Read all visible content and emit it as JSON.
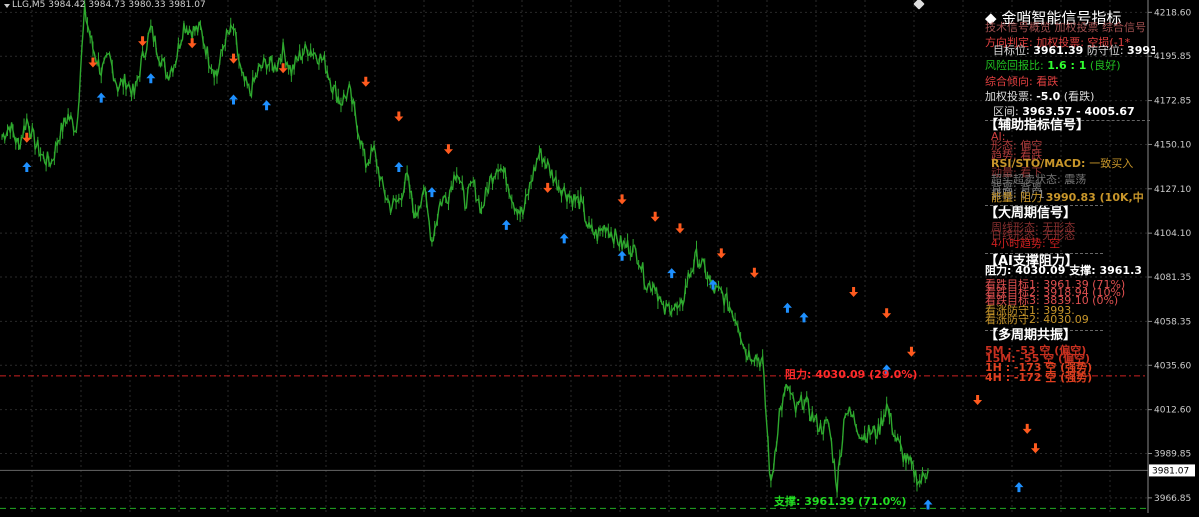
{
  "header": {
    "symbol_timeframe": "LLG,M5",
    "ohlc": "3984.42 3984.73 3980.33 3981.07"
  },
  "colors": {
    "background": "#000000",
    "candle": "#2ea82e",
    "grid": "#2a2a2a",
    "resistance": "#cc2222",
    "support": "#22aa22",
    "buy_arrow": "#1e90ff",
    "sell_arrow": "#ff5a1e"
  },
  "price_axis": {
    "ticks": [
      "4218.60",
      "4195.85",
      "4172.85",
      "4150.10",
      "4127.10",
      "4104.10",
      "4081.35",
      "4058.35",
      "4035.60",
      "4012.60",
      "3989.85",
      "3966.85"
    ],
    "current_price": "3981.07"
  },
  "chart_data": {
    "type": "line",
    "title": "",
    "xlabel": "",
    "ylabel": "",
    "ylim": [
      3959,
      4225
    ],
    "series": [
      {
        "values": [
          4154,
          4160,
          4149,
          4163,
          4151,
          4143,
          4141,
          4156,
          4165,
          4158,
          4219,
          4200,
          4188,
          4195,
          4180,
          4183,
          4176,
          4195,
          4210,
          4197,
          4186,
          4194,
          4212,
          4209,
          4210,
          4195,
          4186,
          4205,
          4210,
          4185,
          4177,
          4188,
          4193,
          4190,
          4199,
          4188,
          4196,
          4200,
          4197,
          4193,
          4180,
          4172,
          4178,
          4160,
          4140,
          4147,
          4128,
          4118,
          4121,
          4133,
          4112,
          4128,
          4100,
          4120,
          4124,
          4138,
          4120,
          4130,
          4116,
          4131,
          4140,
          4133,
          4119,
          4114,
          4131,
          4146,
          4139,
          4131,
          4126,
          4122,
          4120,
          4106,
          4103,
          4108,
          4103,
          4098,
          4097,
          4092,
          4077,
          4078,
          4063,
          4067,
          4063,
          4081,
          4092,
          4085,
          4075,
          4073,
          4066,
          4058,
          4042,
          4041,
          4037,
          3972,
          4010,
          4025,
          4012,
          4018,
          4009,
          4003,
          4005,
          3973,
          4013,
          4008,
          3999,
          4001,
          4001,
          4015,
          3999,
          3989,
          3983,
          3975,
          3981
        ]
      }
    ],
    "buy_signals": [
      {
        "i": 3,
        "price": 4141
      },
      {
        "i": 12,
        "price": 4177
      },
      {
        "i": 18,
        "price": 4187
      },
      {
        "i": 28,
        "price": 4176
      },
      {
        "i": 32,
        "price": 4173
      },
      {
        "i": 48,
        "price": 4141
      },
      {
        "i": 52,
        "price": 4128
      },
      {
        "i": 61,
        "price": 4111
      },
      {
        "i": 68,
        "price": 4104
      },
      {
        "i": 75,
        "price": 4095
      },
      {
        "i": 81,
        "price": 4086
      },
      {
        "i": 86,
        "price": 4080
      },
      {
        "i": 95,
        "price": 4068
      },
      {
        "i": 97,
        "price": 4063
      },
      {
        "i": 107,
        "price": 4036
      },
      {
        "i": 112,
        "price": 3966
      },
      {
        "i": 123,
        "price": 3975
      }
    ],
    "sell_signals": [
      {
        "i": 3,
        "price": 4151
      },
      {
        "i": 11,
        "price": 4190
      },
      {
        "i": 17,
        "price": 4201
      },
      {
        "i": 23,
        "price": 4200
      },
      {
        "i": 28,
        "price": 4192
      },
      {
        "i": 34,
        "price": 4187
      },
      {
        "i": 44,
        "price": 4180
      },
      {
        "i": 48,
        "price": 4162
      },
      {
        "i": 54,
        "price": 4145
      },
      {
        "i": 66,
        "price": 4125
      },
      {
        "i": 75,
        "price": 4119
      },
      {
        "i": 79,
        "price": 4110
      },
      {
        "i": 82,
        "price": 4104
      },
      {
        "i": 87,
        "price": 4091
      },
      {
        "i": 91,
        "price": 4081
      },
      {
        "i": 103,
        "price": 4071
      },
      {
        "i": 107,
        "price": 4060
      },
      {
        "i": 110,
        "price": 4040
      },
      {
        "i": 118,
        "price": 4015
      },
      {
        "i": 124,
        "price": 4000
      },
      {
        "i": 125,
        "price": 3990
      }
    ],
    "resistance_level": 4030.09,
    "support_level": 3961.39
  },
  "levels": {
    "resistance_label": "阻力: 4030.09 (29.0%)",
    "support_label": "支撑: 3961.39 (71.0%)"
  },
  "panel": {
    "title": "金哨智能信号指标",
    "line_garbled1": "技术信号概览 加权投票 综合信号",
    "line_direction": "方向判定: 加权投票: 空损(-1*",
    "target_label": "目标位:",
    "target_value": "3961.39",
    "stop_label": "防守位:",
    "stop_value": "3993.",
    "rr_label": "风险回报比:",
    "rr_value": "1.6 : 1",
    "rr_note": "(良好)",
    "tendency": "综合倾向: 看跌",
    "vote_label": "加权投票:",
    "vote_value": "-5.0",
    "vote_note": "(看跌)",
    "range_label": "区间:",
    "range_value": "3963.57 - 4005.67",
    "aux_title": "【辅助指标信号】",
    "aux_l1": "AI:",
    "aux_l2": "形态: 偏空",
    "aux_l3": "趋势: 看跌",
    "aux_l4": "动量: 看下",
    "rsi_label": "RSI/STO/MACD:",
    "rsi_value": "一致买入",
    "aux_l5": "超买超卖状态: 震荡",
    "aux_l6": "背离: 背离",
    "aux_l7": "背驰: 0 / 1",
    "energy_label": "能量:",
    "energy_kind": "阻力",
    "energy_value": "3990.83 (10K,中",
    "big_title": "【大周期信号】",
    "big_l1": "周线形态: 无形态",
    "big_l2": "日线形态: 无形态",
    "big_l3": "4小时趋势: 空",
    "ai_title": "【AI支撑阻力】",
    "ai_res_label": "阻力:",
    "ai_res_value": "4030.09",
    "ai_sup_label": "支撑:",
    "ai_sup_value": "3961.3",
    "ai_l1": "看跌目标1: 3961.39 (71%)",
    "ai_l2": "看跌目标2: 3918.94 (10%)",
    "ai_l3": "看跌目标3: 3839.10 (0%)",
    "ai_l4": "看涨防守1: 3993.",
    "ai_l5": "看涨防守2: 4030.09",
    "multi_title": "【多周期共振】",
    "multi_l1": "5M : -53 空 (偏空)",
    "multi_l2": "15M: -55 空 (偏空)",
    "multi_l3": "1H : -173 空 (强势)",
    "multi_l4": "4H : -172 空 (强势)"
  }
}
